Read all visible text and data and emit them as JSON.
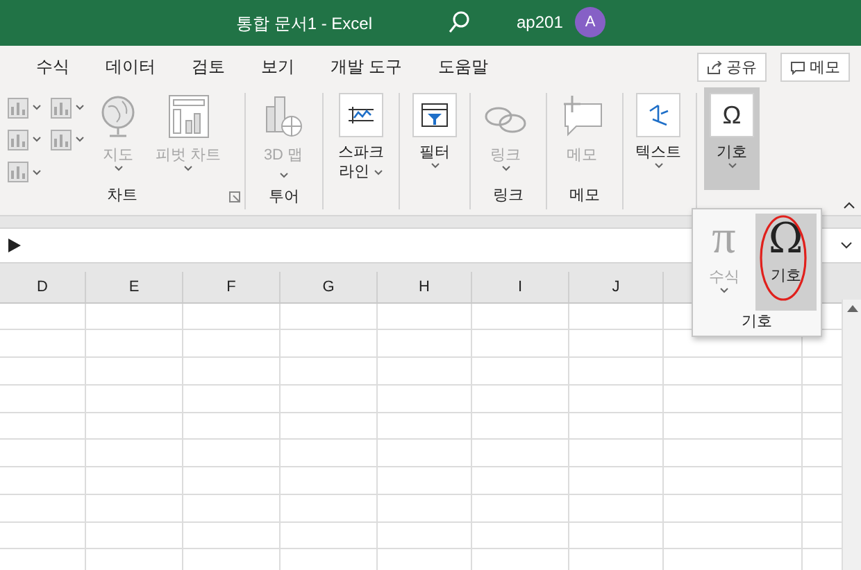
{
  "title_bar": {
    "title": "통합 문서1  -  Excel",
    "account": "ap201",
    "avatar": "A"
  },
  "header_buttons": [
    {
      "kind": "share",
      "label": "공유"
    },
    {
      "kind": "comment",
      "label": "메모"
    }
  ],
  "menu_tabs": [
    "수식",
    "데이터",
    "검토",
    "보기",
    "개발 도구",
    "도움말"
  ],
  "ribbon": [
    {
      "label": "차트",
      "launcher": true,
      "commands": [
        {
          "kind": "chart_gallery",
          "disabled": true
        },
        {
          "kind": "map",
          "label": "지도",
          "disabled": true,
          "dropdown": true,
          "expanded": false
        },
        {
          "kind": "pivot_chart",
          "label": "피벗 차트",
          "disabled": true,
          "dropdown": true,
          "expanded": false
        }
      ]
    },
    {
      "label": "투어",
      "launcher": false,
      "commands": [
        {
          "kind": "map3d",
          "label": "3D 맵",
          "disabled": true,
          "dropdown": true,
          "expanded": false
        }
      ]
    },
    {
      "launcher": false,
      "commands": [
        {
          "kind": "sparkline",
          "label": "스파크 라인",
          "disabled": false,
          "dropdown": true,
          "expanded": false
        }
      ]
    },
    {
      "launcher": false,
      "commands": [
        {
          "kind": "filter",
          "label": "필터",
          "disabled": false,
          "dropdown": true,
          "expanded": false
        }
      ]
    },
    {
      "label": "링크",
      "launcher": false,
      "commands": [
        {
          "kind": "link",
          "label": "링크",
          "disabled": true,
          "dropdown": true,
          "expanded": false
        }
      ]
    },
    {
      "label": "메모",
      "launcher": false,
      "commands": [
        {
          "kind": "memo",
          "label": "메모",
          "disabled": true,
          "dropdown": false,
          "expanded": false
        }
      ]
    },
    {
      "launcher": false,
      "commands": [
        {
          "kind": "text",
          "label": "텍스트",
          "disabled": false,
          "dropdown": true,
          "expanded": false
        }
      ]
    },
    {
      "launcher": false,
      "commands": [
        {
          "kind": "symbol",
          "glyph": "Ω",
          "label": "기호",
          "disabled": false,
          "dropdown": true,
          "expanded": true
        }
      ]
    }
  ],
  "popup": {
    "label": "기호",
    "items": [
      {
        "kind": "equation",
        "glyph": "π",
        "label": "수식",
        "disabled": true,
        "dropdown": true,
        "selected": false
      },
      {
        "kind": "symbol",
        "glyph": "Ω",
        "label": "기호",
        "disabled": false,
        "dropdown": false,
        "selected": true
      }
    ]
  },
  "columns": [
    "D",
    "E",
    "F",
    "G",
    "H",
    "I",
    "J"
  ]
}
